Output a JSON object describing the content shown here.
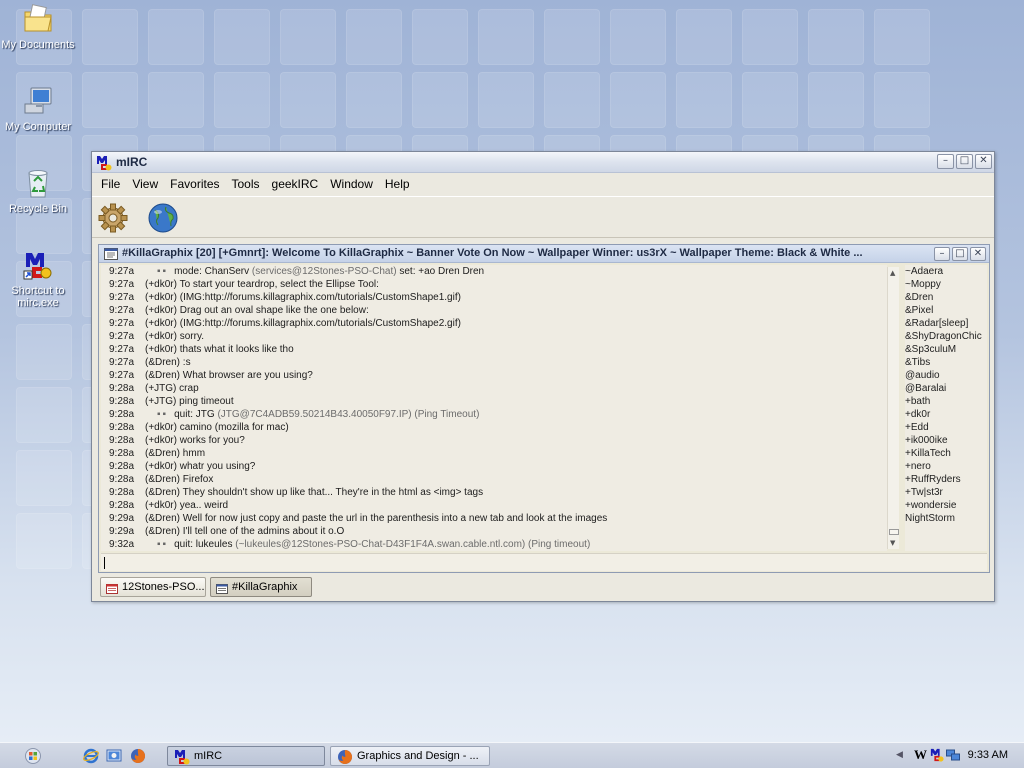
{
  "desktop": {
    "icons": [
      {
        "label": "My Documents"
      },
      {
        "label": "My Computer"
      },
      {
        "label": "Recycle Bin"
      },
      {
        "label": "Shortcut to mirc.exe"
      }
    ]
  },
  "window": {
    "title": "mIRC",
    "menu": [
      "File",
      "View",
      "Favorites",
      "Tools",
      "geekIRC",
      "Window",
      "Help"
    ],
    "toolbar": [
      {
        "icon": "gear-icon"
      },
      {
        "icon": "globe-icon"
      }
    ]
  },
  "channel": {
    "title": "#KillaGraphix [20] [+Gmnrt]:  Welcome To KillaGraphix ~ Banner Vote On Now ~ Wallpaper Winner: us3rX ~ Wallpaper Theme: Black & White ...",
    "messages": [
      {
        "ts": "9:27a",
        "type": "event",
        "main": "mode: ChanServ ",
        "detail": "(services@12Stones-PSO-Chat)",
        "tail": " set: +ao Dren Dren"
      },
      {
        "ts": "9:27a",
        "type": "msg",
        "nick": "(+dk0r)",
        "text": "To start your teardrop, select the Ellipse Tool:"
      },
      {
        "ts": "9:27a",
        "type": "msg",
        "nick": "(+dk0r)",
        "text": "(IMG:http://forums.killagraphix.com/tutorials/CustomShape1.gif)"
      },
      {
        "ts": "9:27a",
        "type": "msg",
        "nick": "(+dk0r)",
        "text": "Drag out an oval shape like the one below:"
      },
      {
        "ts": "9:27a",
        "type": "msg",
        "nick": "(+dk0r)",
        "text": "(IMG:http://forums.killagraphix.com/tutorials/CustomShape2.gif)"
      },
      {
        "ts": "9:27a",
        "type": "msg",
        "nick": "(+dk0r)",
        "text": "sorry."
      },
      {
        "ts": "9:27a",
        "type": "msg",
        "nick": "(+dk0r)",
        "text": "thats what it looks like tho"
      },
      {
        "ts": "9:27a",
        "type": "msg",
        "nick": "(&Dren)",
        "text": ":s"
      },
      {
        "ts": "9:27a",
        "type": "msg",
        "nick": "(&Dren)",
        "text": "What browser are you using?"
      },
      {
        "ts": "9:28a",
        "type": "msg",
        "nick": "(+JTG)",
        "text": "crap"
      },
      {
        "ts": "9:28a",
        "type": "msg",
        "nick": "(+JTG)",
        "text": "ping timeout"
      },
      {
        "ts": "9:28a",
        "type": "event",
        "main": "quit: JTG ",
        "detail": "(JTG@7C4ADB59.50214B43.40050F97.IP) (Ping Timeout)",
        "tail": ""
      },
      {
        "ts": "9:28a",
        "type": "msg",
        "nick": "(+dk0r)",
        "text": "camino (mozilla for mac)"
      },
      {
        "ts": "9:28a",
        "type": "msg",
        "nick": "(+dk0r)",
        "text": "works for you?"
      },
      {
        "ts": "9:28a",
        "type": "msg",
        "nick": "(&Dren)",
        "text": "hmm"
      },
      {
        "ts": "9:28a",
        "type": "msg",
        "nick": "(+dk0r)",
        "text": "whatr you using?"
      },
      {
        "ts": "9:28a",
        "type": "msg",
        "nick": "(&Dren)",
        "text": "Firefox"
      },
      {
        "ts": "9:28a",
        "type": "msg",
        "nick": "(&Dren)",
        "text": "They shouldn't show up like that... They're in the html as <img> tags"
      },
      {
        "ts": "9:28a",
        "type": "msg",
        "nick": "(+dk0r)",
        "text": "yea.. weird"
      },
      {
        "ts": "9:29a",
        "type": "msg",
        "nick": "(&Dren)",
        "text": "Well for now just copy and paste the url in the parenthesis into a new tab and look at the images"
      },
      {
        "ts": "9:29a",
        "type": "msg",
        "nick": "(&Dren)",
        "text": "I'll tell one of the admins about it o.O"
      },
      {
        "ts": "9:32a",
        "type": "event",
        "main": "quit: lukeules ",
        "detail": "(~lukeules@12Stones-PSO-Chat-D43F1F4A.swan.cable.ntl.com) (Ping timeout)",
        "tail": ""
      }
    ],
    "nicks": [
      "~Adaera",
      "~Moppy",
      "&Dren",
      "&Pixel",
      "&Radar[sleep]",
      "&ShyDragonChic",
      "&Sp3culuM",
      "&Tibs",
      "@audio",
      "@Baralai",
      "+bath",
      "+dk0r",
      "+Edd",
      "+ik000ike",
      "+KillaTech",
      "+nero",
      "+RuffRyders",
      "+Tw|st3r",
      "+wondersie",
      "NightStorm"
    ],
    "input_value": ""
  },
  "switchbar": [
    {
      "label": "12Stones-PSO..."
    },
    {
      "label": "#KillaGraphix"
    }
  ],
  "taskbar": {
    "tasks": [
      {
        "label": "mIRC"
      },
      {
        "label": "Graphics and Design - ..."
      }
    ],
    "tray_letter": "W",
    "clock": "9:33 AM"
  },
  "colors": {
    "desktop": "#a9bbd9",
    "window_bg": "#ebe9e0",
    "chat_bg": "#efece3"
  }
}
